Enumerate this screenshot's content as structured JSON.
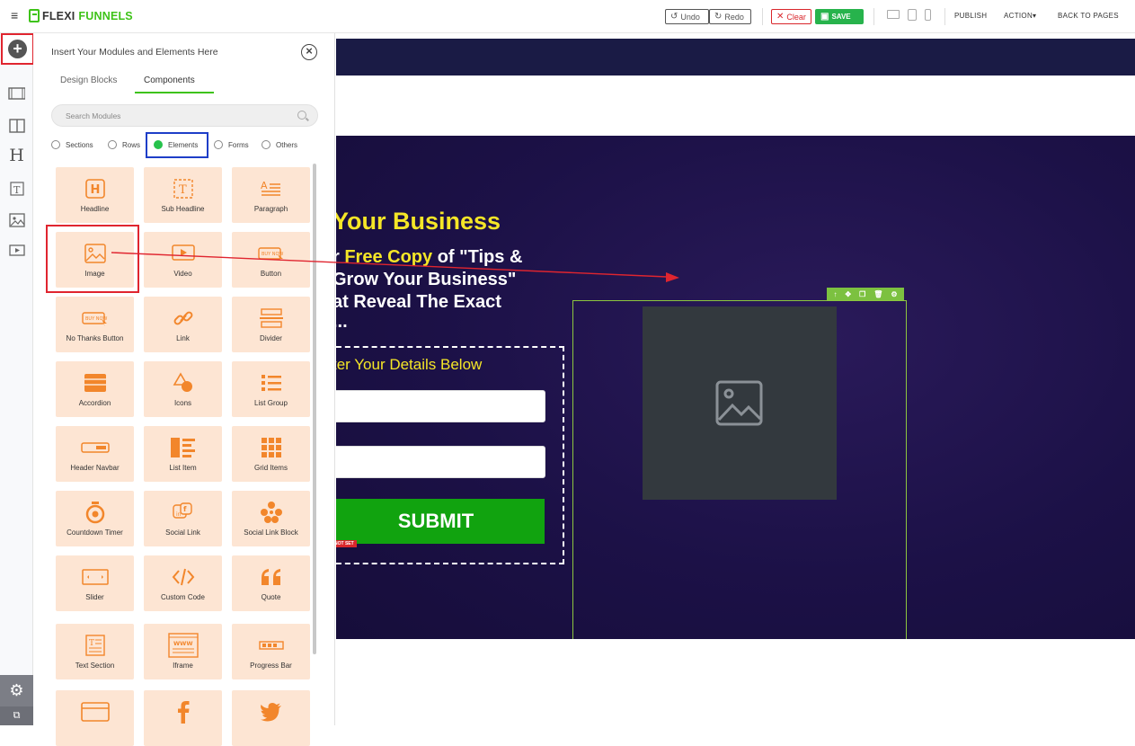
{
  "topbar": {
    "brand_part1": "FLEXI",
    "brand_part2": "FUNNELS",
    "undo": "Undo",
    "redo": "Redo",
    "clear": "Clear",
    "save": "SAVE",
    "publish": "PUBLISH",
    "action": "ACTION",
    "back_to_pages": "BACK TO PAGES"
  },
  "panel": {
    "title": "Insert Your Modules and Elements Here",
    "tabs": [
      "Design Blocks",
      "Components"
    ],
    "active_tab": "Components",
    "search_placeholder": "Search Modules",
    "filters": [
      "Sections",
      "Rows",
      "Elements",
      "Forms",
      "Others"
    ],
    "selected_filter": "Elements",
    "modules": [
      {
        "label": "Headline",
        "icon": "headline-icon"
      },
      {
        "label": "Sub Headline",
        "icon": "sub-headline-icon"
      },
      {
        "label": "Paragraph",
        "icon": "paragraph-icon"
      },
      {
        "label": "Image",
        "icon": "image-icon"
      },
      {
        "label": "Video",
        "icon": "video-icon"
      },
      {
        "label": "Button",
        "icon": "button-icon"
      },
      {
        "label": "No Thanks Button",
        "icon": "no-thanks-button-icon"
      },
      {
        "label": "Link",
        "icon": "link-icon"
      },
      {
        "label": "Divider",
        "icon": "divider-icon"
      },
      {
        "label": "Accordion",
        "icon": "accordion-icon"
      },
      {
        "label": "Icons",
        "icon": "icons-icon"
      },
      {
        "label": "List Group",
        "icon": "list-group-icon"
      },
      {
        "label": "Header Navbar",
        "icon": "header-navbar-icon"
      },
      {
        "label": "List Item",
        "icon": "list-item-icon"
      },
      {
        "label": "Grid Items",
        "icon": "grid-items-icon"
      },
      {
        "label": "Countdown Timer",
        "icon": "countdown-timer-icon"
      },
      {
        "label": "Social Link",
        "icon": "social-link-icon"
      },
      {
        "label": "Social Link Block",
        "icon": "social-link-block-icon"
      },
      {
        "label": "Slider",
        "icon": "slider-icon"
      },
      {
        "label": "Custom Code",
        "icon": "custom-code-icon"
      },
      {
        "label": "Quote",
        "icon": "quote-icon"
      },
      {
        "label": "Text Section",
        "icon": "text-section-icon"
      },
      {
        "label": "Iframe",
        "icon": "iframe-icon"
      },
      {
        "label": "Progress Bar",
        "icon": "progress-bar-icon"
      },
      {
        "label": "",
        "icon": "browser-window-icon"
      },
      {
        "label": "",
        "icon": "facebook-icon"
      },
      {
        "label": "",
        "icon": "twitter-icon"
      }
    ]
  },
  "canvas": {
    "headline": "Your Business",
    "sub_line1_pre": "r ",
    "sub_line1_highlight": "Free Copy",
    "sub_line1_post": " of \"Tips &",
    "sub_line2": " Grow Your Business\"",
    "sub_line3": "at Reveal The Exact",
    "sub_line4": "...",
    "form_title": "ter Your Details Below",
    "submit_label": "SUBMIT",
    "link_badge": "K NOT SET"
  },
  "colors": {
    "brand_green": "#3ec318",
    "tile_bg": "#fde5d3",
    "tile_icon": "#f2862b",
    "hero_bg": "#1c1147",
    "headline_yellow": "#f5e627",
    "submit_green": "#11a30f",
    "annotation_red": "#e0252f",
    "annotation_blue": "#1e3ec8"
  }
}
